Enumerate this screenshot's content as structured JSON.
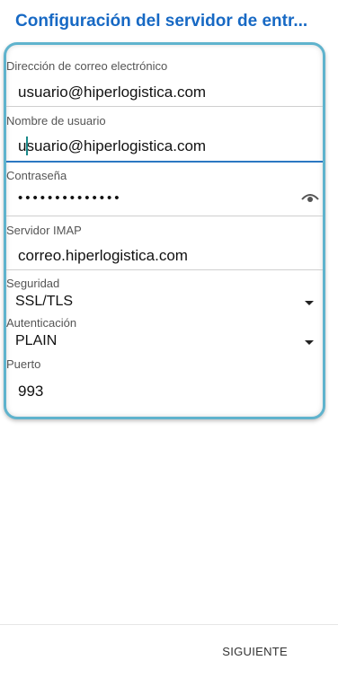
{
  "header": {
    "title": "Configuración del servidor de entr..."
  },
  "form": {
    "email": {
      "label": "Dirección de correo electrónico",
      "value": "usuario@hiperlogistica.com"
    },
    "username": {
      "label": "Nombre de usuario",
      "value": "usuario@hiperlogistica.com"
    },
    "password": {
      "label": "Contraseña",
      "value": "••••••••••••••",
      "icon": "eye-icon"
    },
    "imap_server": {
      "label": "Servidor IMAP",
      "value": "correo.hiperlogistica.com"
    },
    "security": {
      "label": "Seguridad",
      "value": "SSL/TLS"
    },
    "authentication": {
      "label": "Autenticación",
      "value": "PLAIN"
    },
    "port": {
      "label": "Puerto",
      "value": "993"
    }
  },
  "footer": {
    "next_label": "SIGUIENTE"
  },
  "colors": {
    "title": "#1769c4",
    "active_underline": "#2b78c2",
    "card_border": "#5fb3cd"
  }
}
